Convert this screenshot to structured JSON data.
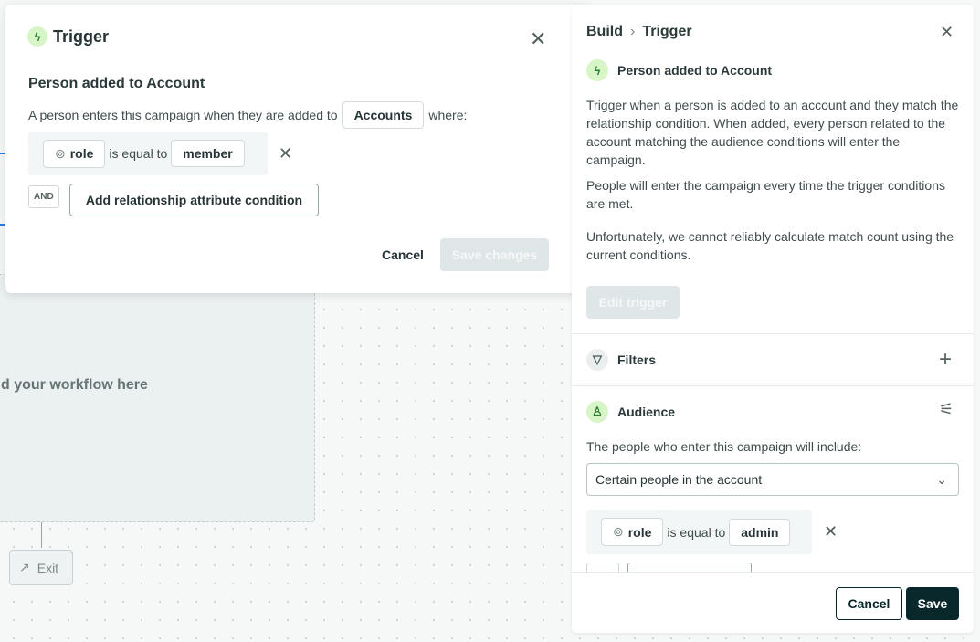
{
  "canvas": {
    "workflow_hint": "d your workflow here",
    "exit_label": "Exit"
  },
  "modal": {
    "title": "Trigger",
    "subtitle": "Person added to Account",
    "sentence_prefix": "A person enters this campaign when they are added to",
    "object_chip": "Accounts",
    "sentence_suffix": "where:",
    "condition": {
      "attribute": "role",
      "operator": "is equal to",
      "value": "member"
    },
    "and_label": "AND",
    "add_condition_label": "Add relationship attribute condition",
    "cancel_label": "Cancel",
    "save_label": "Save changes"
  },
  "panel": {
    "breadcrumb": [
      "Build",
      "Trigger"
    ],
    "trigger_name": "Person added to Account",
    "paragraphs": [
      "Trigger when a person is added to an account and they match the relationship condition. When added, every person related to the account matching the audience conditions will enter the campaign.",
      "People will enter the campaign every time the trigger conditions are met.",
      "Unfortunately, we cannot reliably calculate match count using the current conditions."
    ],
    "edit_trigger_label": "Edit trigger",
    "filters_label": "Filters",
    "audience_label": "Audience",
    "audience_intro": "The people who enter this campaign will include:",
    "audience_select": "Certain people in the account",
    "condition": {
      "attribute": "role",
      "operator": "is equal to",
      "value": "admin"
    },
    "cancel_label": "Cancel",
    "save_label": "Save"
  },
  "colors": {
    "primary": "#08282c",
    "accent_green": "#d8f5c7",
    "disabled": "#dfe6e7"
  }
}
